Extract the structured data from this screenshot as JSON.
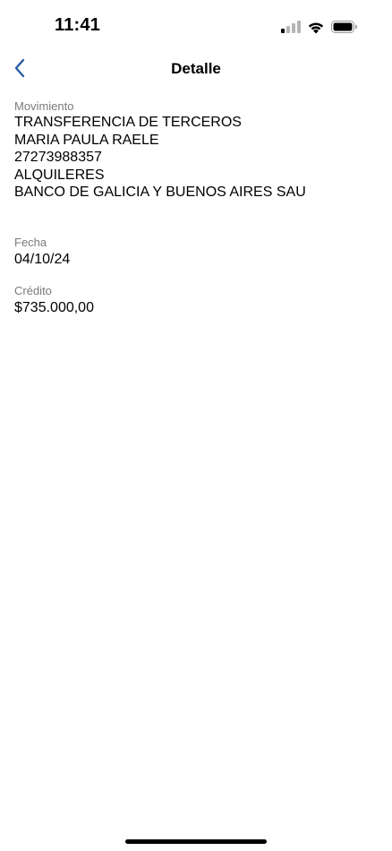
{
  "status_bar": {
    "time": "11:41"
  },
  "nav": {
    "title": "Detalle",
    "back_icon": "chevron-left-icon"
  },
  "movimiento": {
    "label": "Movimiento",
    "lines": [
      "TRANSFERENCIA DE TERCEROS",
      "MARIA PAULA RAELE",
      "27273988357",
      "ALQUILERES",
      "BANCO DE GALICIA Y BUENOS AIRES SAU"
    ]
  },
  "fecha": {
    "label": "Fecha",
    "value": "04/10/24"
  },
  "credito": {
    "label": "Crédito",
    "value": "$735.000,00"
  },
  "colors": {
    "accent": "#2a5d9f",
    "label_gray": "#7a7a7a",
    "text": "#000000",
    "background": "#ffffff"
  }
}
